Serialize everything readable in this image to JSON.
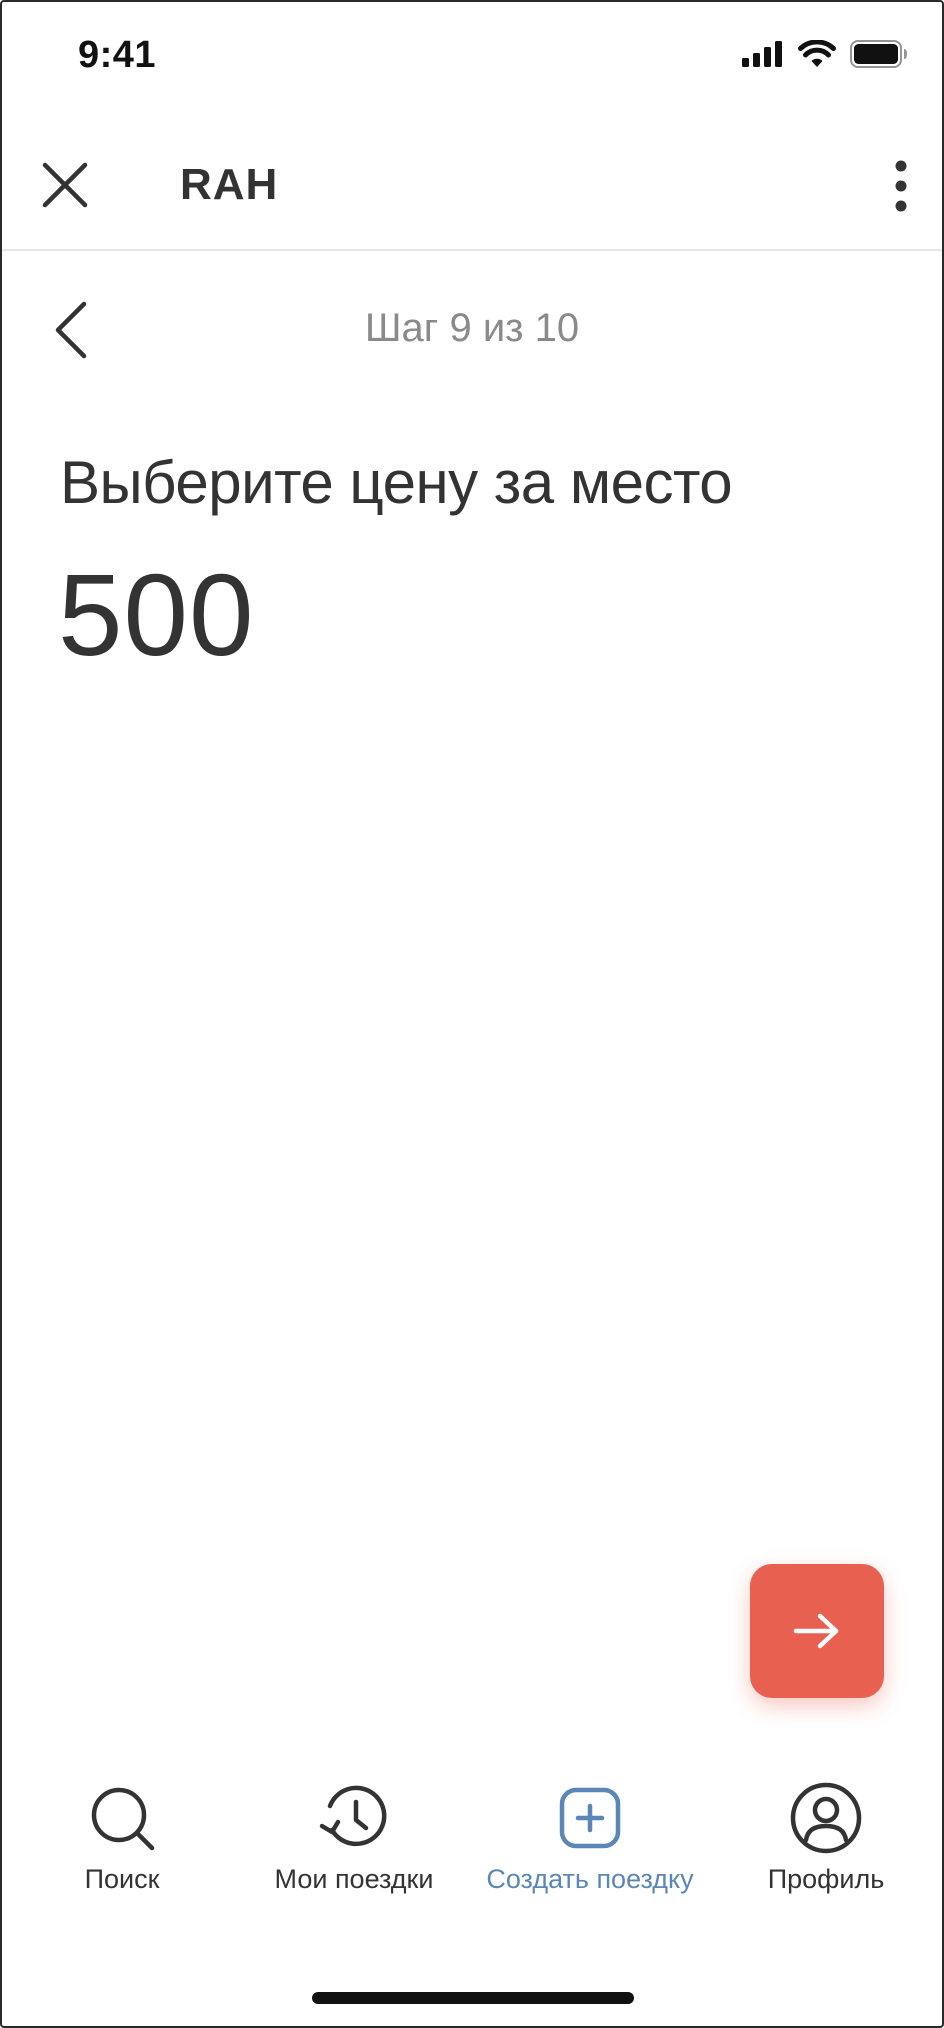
{
  "status_bar": {
    "time": "9:41",
    "icons": [
      "signal-icon",
      "wifi-icon",
      "battery-icon"
    ]
  },
  "header": {
    "title": "RAH",
    "close_icon": "close-icon",
    "menu_icon": "more-vertical-icon"
  },
  "step": {
    "back_icon": "chevron-left-icon",
    "label": "Шаг 9 из 10"
  },
  "form": {
    "question": "Выберите цену за место",
    "price_value": "500"
  },
  "next_button": {
    "icon": "arrow-right-icon",
    "color": "#e8604f"
  },
  "tab_bar": {
    "active_color": "#5b86b8",
    "tabs": [
      {
        "label": "Поиск",
        "icon": "search-icon",
        "active": false
      },
      {
        "label": "Мои поездки",
        "icon": "history-icon",
        "active": false
      },
      {
        "label": "Создать поездку",
        "icon": "plus-square-icon",
        "active": true
      },
      {
        "label": "Профиль",
        "icon": "profile-icon",
        "active": false
      }
    ]
  }
}
